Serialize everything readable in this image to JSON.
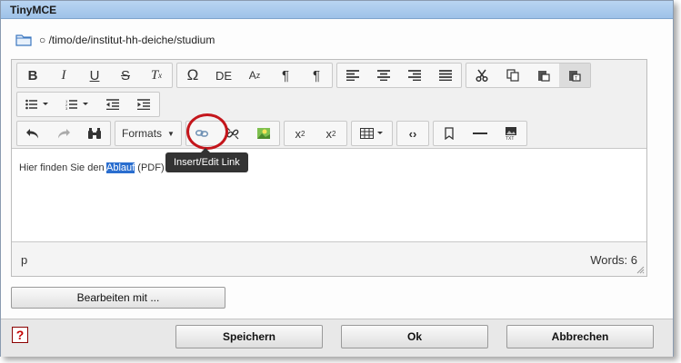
{
  "window": {
    "title": "TinyMCE"
  },
  "path": {
    "icon": "folder-icon",
    "text": "○ /timo/de/institut-hh-deiche/studium"
  },
  "toolbar": {
    "formats_label": "Formats",
    "special_char_label": "Ω",
    "lang_label": "DE",
    "tooltip": "Insert/Edit Link"
  },
  "content": {
    "before": "Hier finden Sie den ",
    "selected": "Ablauf",
    "after": " (PDF)"
  },
  "status": {
    "element_path": "p",
    "word_count": "Words: 6"
  },
  "edit_with_label": "Bearbeiten mit ...",
  "footer": {
    "help_label": "?",
    "save_label": "Speichern",
    "ok_label": "Ok",
    "cancel_label": "Abbrechen"
  },
  "colors": {
    "selection": "#2a6ecf",
    "highlight_circle": "#c4161c",
    "titlebar": "#a9c9ec"
  }
}
